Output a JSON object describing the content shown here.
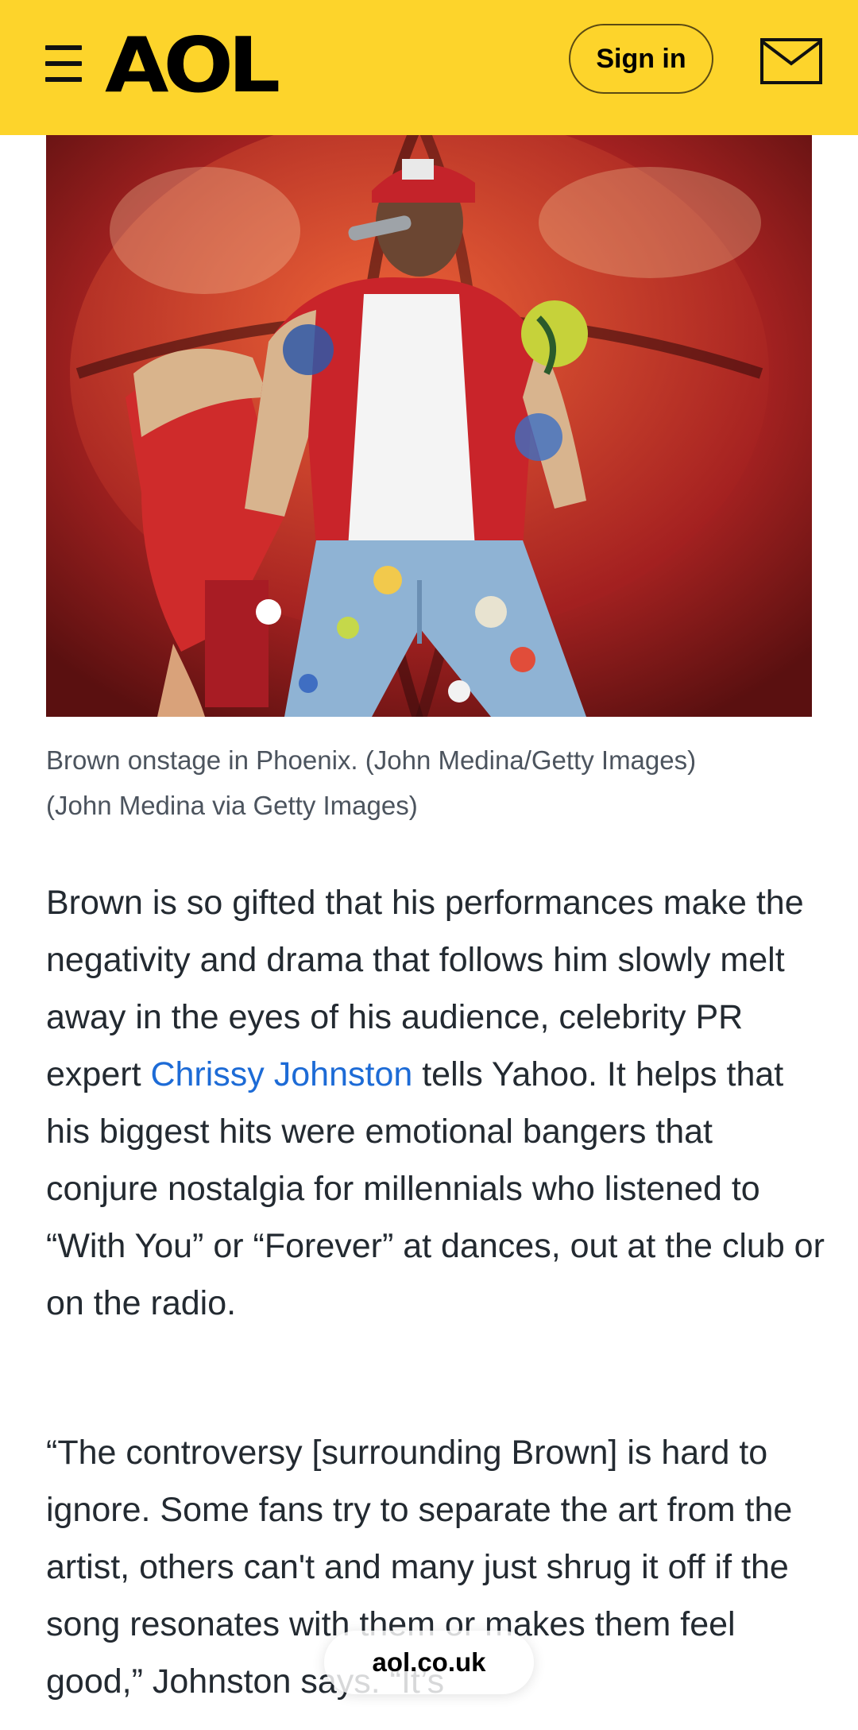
{
  "header": {
    "logo": "AOL",
    "signin_label": "Sign in",
    "menu_icon": "hamburger-menu-icon",
    "mail_icon": "mail-envelope-icon",
    "background_color": "#fdd42b"
  },
  "article": {
    "image": {
      "description_icon": "concert-photo"
    },
    "caption_line1": "Brown onstage in Phoenix. (John Medina/Getty Images)",
    "caption_line2": "(John Medina via Getty Images)",
    "paragraph1": {
      "text_before_link": "Brown is so gifted that his performances make the negativity and drama that follows him slowly melt away in the eyes of his audience, celebrity PR expert ",
      "link_text": "Chrissy Johnston",
      "text_after_link": " tells Yahoo. It helps that his biggest hits were emotional bangers that conjure nostalgia for millennials who listened to “With You” or “Forever” at dances, out at the club or on the radio."
    },
    "paragraph2": {
      "text": "“The controversy [surrounding Brown] is hard to ignore. Some fans try to separate the art from the artist, others can't and many just shrug it off if the song resonates with them or makes them feel good,” Johnston says. “It’s"
    },
    "link_color": "#1d6bd6"
  },
  "browser": {
    "url_pill": "aol.co.uk"
  }
}
